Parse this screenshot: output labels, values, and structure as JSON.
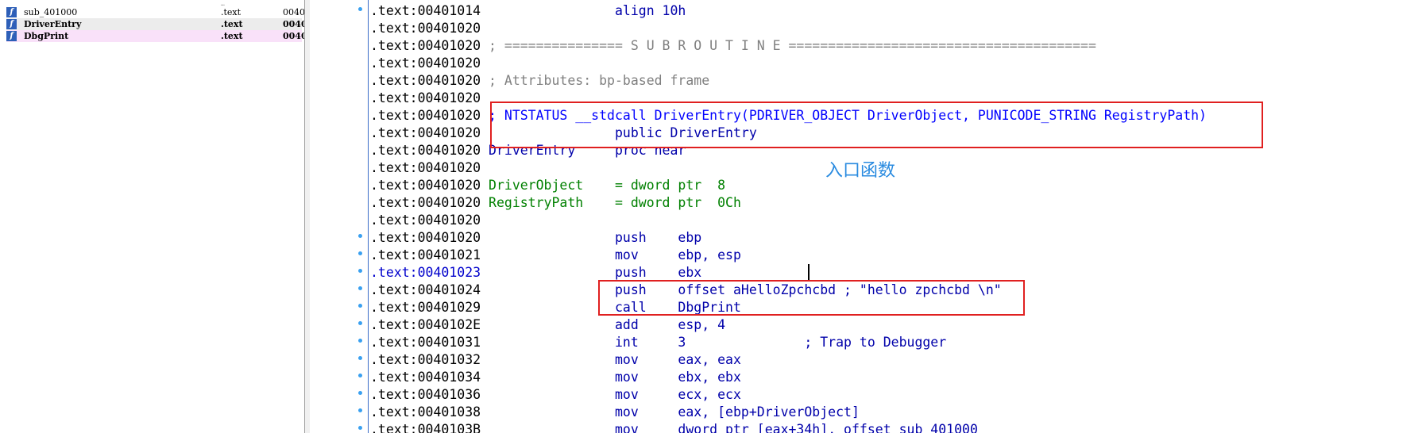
{
  "functions_pane": {
    "rows": [
      {
        "name": "sub_401000",
        "segment": ".text",
        "start": "0040"
      },
      {
        "name": "DriverEntry",
        "segment": ".text",
        "start": "0040"
      },
      {
        "name": "DbgPrint",
        "segment": ".text",
        "start": "0040"
      }
    ]
  },
  "disasm": {
    "lines": [
      {
        "addr": ".text:00401014",
        "text": "                align 10h"
      },
      {
        "addr": ".text:00401020",
        "text": ""
      },
      {
        "addr": ".text:00401020",
        "text": "; =============== S U B R O U T I N E ======================================="
      },
      {
        "addr": ".text:00401020",
        "text": ""
      },
      {
        "addr": ".text:00401020",
        "text": "; Attributes: bp-based frame"
      },
      {
        "addr": ".text:00401020",
        "text": ""
      },
      {
        "addr": ".text:00401020",
        "text": "; NTSTATUS __stdcall DriverEntry(PDRIVER_OBJECT DriverObject, PUNICODE_STRING RegistryPath)"
      },
      {
        "addr": ".text:00401020",
        "text": "                public DriverEntry"
      },
      {
        "addr": ".text:00401020",
        "text": "DriverEntry     proc near"
      },
      {
        "addr": ".text:00401020",
        "text": ""
      },
      {
        "addr": ".text:00401020",
        "text": "DriverObject    = dword ptr  8"
      },
      {
        "addr": ".text:00401020",
        "text": "RegistryPath    = dword ptr  0Ch"
      },
      {
        "addr": ".text:00401020",
        "text": ""
      },
      {
        "addr": ".text:00401020",
        "text": "                push    ebp"
      },
      {
        "addr": ".text:00401021",
        "text": "                mov     ebp, esp"
      },
      {
        "addr": ".text:00401023",
        "text": "                push    ebx"
      },
      {
        "addr": ".text:00401024",
        "text": "                push    offset aHelloZpchcbd ; \"hello zpchcbd \\n\""
      },
      {
        "addr": ".text:00401029",
        "text": "                call    DbgPrint"
      },
      {
        "addr": ".text:0040102E",
        "text": "                add     esp, 4"
      },
      {
        "addr": ".text:00401031",
        "text": "                int     3               ; Trap to Debugger"
      },
      {
        "addr": ".text:00401032",
        "text": "                mov     eax, eax"
      },
      {
        "addr": ".text:00401034",
        "text": "                mov     ebx, ebx"
      },
      {
        "addr": ".text:00401036",
        "text": "                mov     ecx, ecx"
      },
      {
        "addr": ".text:00401038",
        "text": "                mov     eax, [ebp+DriverObject]"
      },
      {
        "addr": ".text:0040103B",
        "text": "                mov     dword ptr [eax+34h], offset sub_401000"
      }
    ]
  },
  "annotation": "入口函数",
  "colors": {
    "highlight_box": "#e02020",
    "annotation": "#2a8be0",
    "comment": "#808080",
    "keyword": "#0000ff",
    "name": "#008000"
  }
}
